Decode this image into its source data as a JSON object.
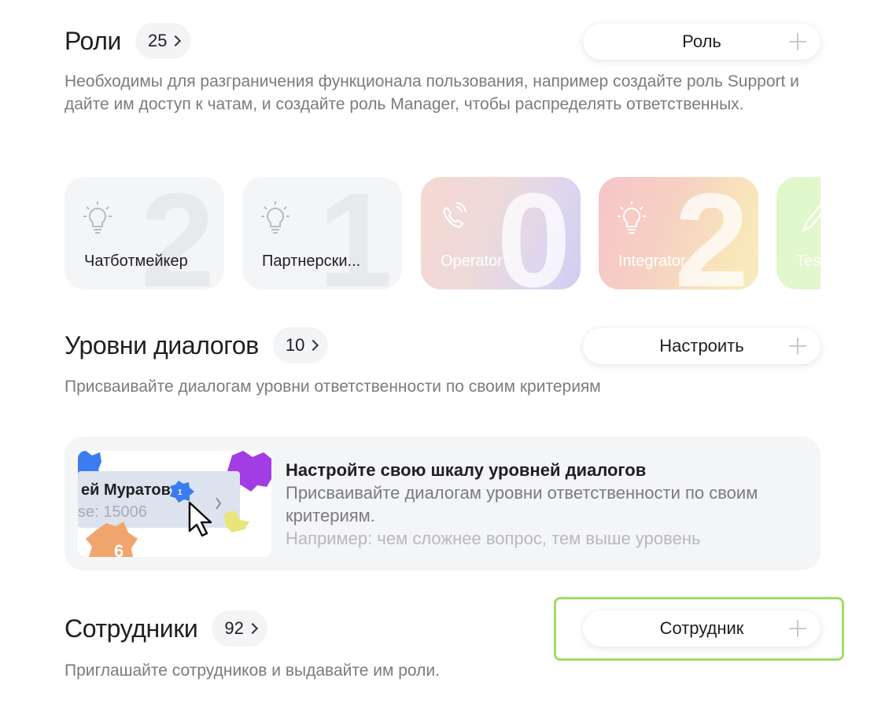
{
  "roles": {
    "title": "Роли",
    "count": "25",
    "button_label": "Роль",
    "description": "Необходимы для разграничения функционала пользования, например создайте роль Support и дайте им доступ к чатам, и создайте роль Manager, чтобы распределять ответственных.",
    "cards": [
      {
        "name": "Чатботмейкер",
        "number": "2",
        "icon": "lightbulb-icon"
      },
      {
        "name": "Партнерски...",
        "number": "1",
        "icon": "lightbulb-icon"
      },
      {
        "name": "Operator",
        "number": "0",
        "icon": "phone-icon"
      },
      {
        "name": "Integrator",
        "number": "2",
        "icon": "lightbulb-icon"
      },
      {
        "name": "Tes",
        "number": "",
        "icon": "pencil-icon"
      }
    ]
  },
  "dialog_levels": {
    "title": "Уровни диалогов",
    "count": "10",
    "button_label": "Настроить",
    "description": "Присваивайте диалогам уровни ответственности по своим критериям",
    "promo": {
      "title": "Настройте свою шкалу уровней диалогов",
      "subtitle": "Присваивайте диалогам уровни ответственности по своим критериям.",
      "example": "Например: чем сложнее вопрос, тем выше уровень",
      "image_name": "ей Муратов",
      "image_badge": "1",
      "image_sub": "se: 15006",
      "image_level": "6"
    }
  },
  "employees": {
    "title": "Сотрудники",
    "count": "92",
    "button_label": "Сотрудник",
    "description": "Приглашайте сотрудников и выдавайте им роли."
  },
  "colors": {
    "highlight": "#9fdc6a",
    "card_bg": "#f4f5f7",
    "muted_text": "#7b7b80"
  }
}
